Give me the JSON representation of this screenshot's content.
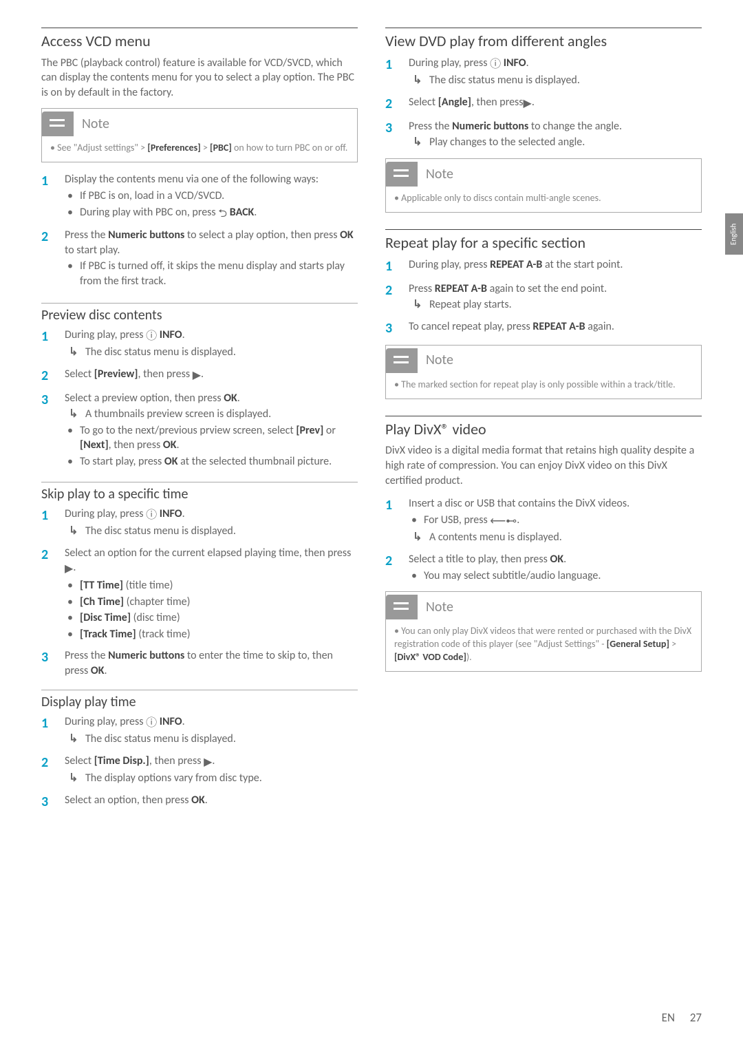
{
  "side_tab": "English",
  "footer": {
    "lang": "EN",
    "page": "27"
  },
  "left": {
    "s1": {
      "title": "Access VCD menu",
      "intro": "The PBC (playback control) feature is available for VCD/SVCD, which can display the contents menu for you to select a play option. The PBC is on by default in the factory.",
      "note_title": "Note",
      "note_li1a": "See \"Adjust settings\" > ",
      "note_li1b": "[Preferences]",
      "note_li1c": " > ",
      "note_li1d": "[PBC]",
      "note_li1e": " on how to turn PBC on or off.",
      "st1": "Display the contents menu via one of the following ways:",
      "st1a": "If PBC is on, load in a VCD/SVCD.",
      "st1b_a": "During play with PBC on, press ",
      "st1b_b": "BACK",
      "st1b_c": ".",
      "st2a": "Press the ",
      "st2b": "Numeric buttons",
      "st2c": " to select a play option, then press ",
      "st2d": "OK",
      "st2e": " to start play.",
      "st2sub": "If PBC is turned off, it skips the menu display and starts play from the first track."
    },
    "s2": {
      "title": "Preview disc contents",
      "st1a": "During play, press ",
      "st1b": "INFO",
      "st1c": ".",
      "st1res": "The disc status menu is displayed.",
      "st2a": "Select ",
      "st2b": "[Preview]",
      "st2c": ", then press ",
      "st2d": ".",
      "st3a": "Select a preview option, then press ",
      "st3b": "OK",
      "st3c": ".",
      "st3res": "A thumbnails preview screen is displayed.",
      "st3s1a": "To go to the next/previous prview screen, select ",
      "st3s1b": "[Prev]",
      "st3s1c": " or ",
      "st3s1d": "[Next]",
      "st3s1e": ", then press ",
      "st3s1f": "OK",
      "st3s1g": ".",
      "st3s2a": "To start play, press ",
      "st3s2b": "OK",
      "st3s2c": " at the selected thumbnail picture."
    },
    "s3": {
      "title": "Skip play to a specific time",
      "st1a": "During play, press ",
      "st1b": "INFO",
      "st1c": ".",
      "st1res": "The disc status menu is displayed.",
      "st2a": "Select an option for the current elapsed playing time, then press ",
      "st2b": ".",
      "st2s1a": "[TT Time]",
      "st2s1b": " (title time)",
      "st2s2a": "[Ch Time]",
      "st2s2b": " (chapter time)",
      "st2s3a": "[Disc Time]",
      "st2s3b": " (disc time)",
      "st2s4a": "[Track Time]",
      "st2s4b": " (track time)",
      "st3a": "Press the ",
      "st3b": "Numeric buttons",
      "st3c": " to enter the time to skip to, then press ",
      "st3d": "OK",
      "st3e": "."
    },
    "s4": {
      "title": "Display play time",
      "st1a": "During play, press ",
      "st1b": "INFO",
      "st1c": ".",
      "st1res": "The disc status menu is displayed.",
      "st2a": "Select ",
      "st2b": "[Time Disp.]",
      "st2c": ", then press ",
      "st2d": ".",
      "st2res": "The display options vary from disc type.",
      "st3a": "Select an option, then press ",
      "st3b": "OK",
      "st3c": "."
    }
  },
  "right": {
    "s1": {
      "title": "View DVD play from different angles",
      "st1a": "During play, press ",
      "st1b": "INFO",
      "st1c": ".",
      "st1res": "The disc status menu is displayed.",
      "st2a": "Select ",
      "st2b": "[Angle]",
      "st2c": ", then press",
      "st2d": ".",
      "st3a": "Press the ",
      "st3b": "Numeric buttons",
      "st3c": " to change the angle.",
      "st3res": "Play changes to the selected angle.",
      "note_title": "Note",
      "note_li1": "Applicable only to discs contain multi-angle scenes."
    },
    "s2": {
      "title": "Repeat play for a specific section",
      "st1a": "During play, press ",
      "st1b": "REPEAT A-B",
      "st1c": " at the start point.",
      "st2a": "Press ",
      "st2b": "REPEAT A-B",
      "st2c": " again to set the end point.",
      "st2res": "Repeat play starts.",
      "st3a": "To cancel repeat play, press ",
      "st3b": "REPEAT A-B",
      "st3c": " again.",
      "note_title": "Note",
      "note_li1": "The marked section for repeat play is only possible within a track/title."
    },
    "s3": {
      "title": "Play DivX® video",
      "intro": "DivX video is a digital media format that retains high quality despite a high rate of compression. You can enjoy DivX video on this DivX certified product.",
      "st1": "Insert a disc or USB that contains the DivX videos.",
      "st1s1a": "For USB, press ",
      "st1s1b": ".",
      "st1res": "A contents menu is displayed.",
      "st2a": "Select a title to play, then press ",
      "st2b": "OK",
      "st2c": ".",
      "st2s1": "You may select subtitle/audio language.",
      "note_title": "Note",
      "note_li1a": "You can only play DivX videos that were rented or purchased with the DivX registration code of this player (see \"Adjust Settings\" - ",
      "note_li1b": "[General Setup]",
      "note_li1c": " > ",
      "note_li1d": "[DivX® VOD Code]",
      "note_li1e": ")."
    }
  }
}
